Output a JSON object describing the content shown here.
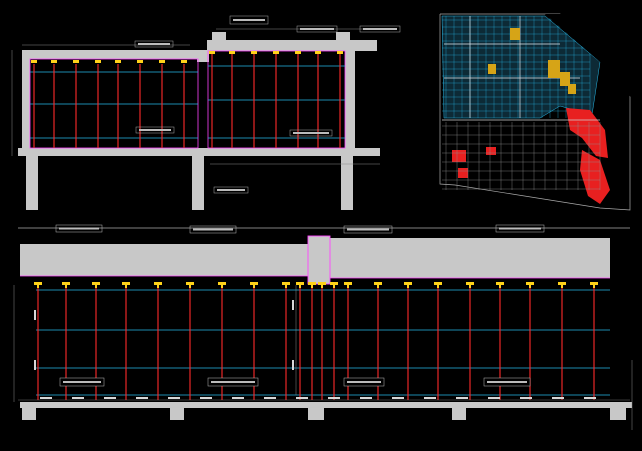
{
  "colors": {
    "background": "#000000",
    "concrete": "#c8c8c8",
    "shore_post": "#ff2a2a",
    "ledger": "#27b8e8",
    "beam_edge": "#ff44ff",
    "jack_head": "#ffd21a",
    "grid_line": "#ffffff"
  },
  "top_section": {
    "callouts": [
      "",
      "",
      "",
      "",
      "",
      "",
      ""
    ]
  },
  "bottom_section": {
    "callouts": [
      "",
      "",
      "",
      ""
    ],
    "bay_labels": [
      "",
      "",
      "",
      ""
    ],
    "dimensions": [
      "",
      "",
      "",
      "",
      "",
      "",
      "",
      "",
      "",
      "",
      "",
      "",
      "",
      "",
      "",
      "",
      "",
      ""
    ]
  },
  "plan_view": {
    "hatched_zones": [
      "teal-grid-zone",
      "yellow-zone",
      "red-zone"
    ]
  }
}
